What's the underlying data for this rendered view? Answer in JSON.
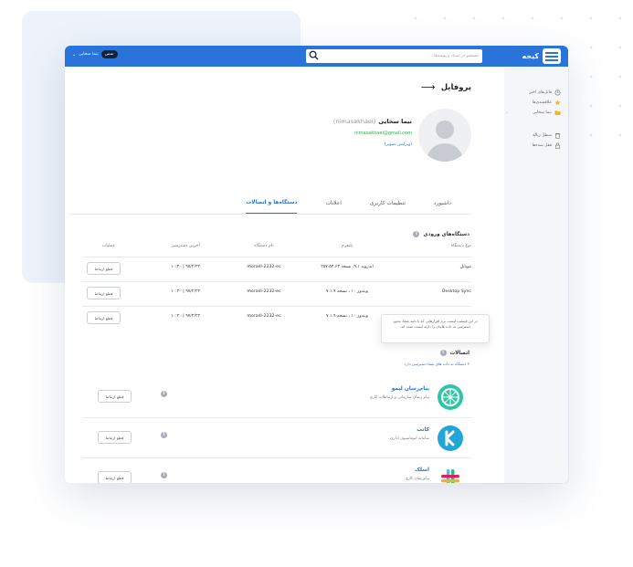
{
  "app": {
    "logo_text": "کیجه"
  },
  "search": {
    "placeholder": "جستجو در اسناد و پوشه‌ها..."
  },
  "user": {
    "badge": "نمس",
    "name": "نیما سخایی"
  },
  "sidebar": {
    "items": [
      {
        "label": "فایل‌های اخیر",
        "icon": "clock-icon"
      },
      {
        "label": "علاقمندی‌ها",
        "icon": "star-icon"
      },
      {
        "label": "نیما سخایی",
        "icon": "folder-icon"
      },
      {
        "label": "سطل زباله",
        "icon": "trash-icon"
      },
      {
        "label": "قفل شده‌ها",
        "icon": "lock-icon"
      }
    ]
  },
  "page": {
    "title": "پروفایل"
  },
  "profile": {
    "name": "نیما سخایی",
    "username": "(nimasakhaei)",
    "email": "nimasakhaei@gmail.com",
    "edit": "(ویرایش تصویر)"
  },
  "tabs": [
    "داشبورد",
    "تنظیمات کاربری",
    "اعلانات",
    "دستگاه‌ها و اتصالات"
  ],
  "devices": {
    "title": "دستگاه‌های ورودی",
    "columns": [
      "نوع دستگاه",
      "پلتفرم",
      "نام دستگاه",
      "آخرین دسترسی",
      "عملیات"
    ],
    "rows": [
      {
        "type": "موبایل",
        "platform": "اندروید ۹.۱، نسخه ۴۵۷.۵۴.۶۳",
        "name": "moradi-2232-ec",
        "last": "۹۷/۲/۲۴ | ۱۰:۴۰",
        "action": "قطع ارتباط"
      },
      {
        "type": "Desktop Sync",
        "platform": "ویندوز ۱۰ ، نسخه ۷.۱.۹",
        "name": "moradi-2232-ec",
        "last": "۹۷/۲/۲۴ | ۱۰:۴۰",
        "action": "قطع ارتباط"
      },
      {
        "type": "",
        "platform": "ویندوز ۱۰ ، نسخه ۷.۱.۹",
        "name": "moradi-2232-ec",
        "last": "۹۷/۲/۲۴ | ۱۰:۴۰",
        "action": "قطع ارتباط"
      }
    ]
  },
  "tooltip": {
    "text": "در این قسمت لیست نرم افزارهایی که با تایید شما، مجوز دسترسی به داده هایتان را دارند لیست شده اند."
  },
  "connections": {
    "title": "اتصالات",
    "subtitle": "۲ دستگاه به داده های شما دسترسی دارد",
    "items": [
      {
        "name": "پیام‌رسان لیمو",
        "desc": "پیام رسان سازمانی و ارتباطات کاری",
        "action": "قطع ارتباط",
        "icon": "limoo-logo-icon"
      },
      {
        "name": "کاتب",
        "desc": "سامانه اتوماسیون اداری",
        "action": "قطع ارتباط",
        "icon": "kateb-logo-icon"
      },
      {
        "name": "اسلک",
        "desc": "پیام‌رسان کاری",
        "action": "قطع ارتباط",
        "icon": "slack-logo-icon"
      }
    ]
  },
  "colors": {
    "primary": "#2a73db",
    "email": "#2fae4a",
    "background_card": "#eef3fb"
  }
}
